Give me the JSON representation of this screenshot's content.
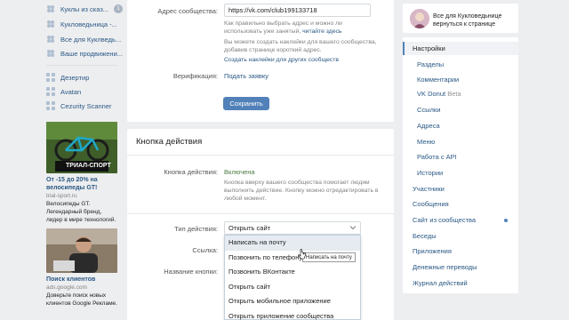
{
  "left_nav": {
    "items": [
      {
        "label": "Куклы из сказ...",
        "count": "1",
        "icon": "doll-icon"
      },
      {
        "label": "Кукловедьница -...",
        "icon": "doll-icon"
      },
      {
        "label": "Все для Куклведь...",
        "icon": "doll-icon"
      },
      {
        "label": "Ваше продвижени...",
        "icon": "doll-icon"
      }
    ],
    "apps": [
      {
        "label": "Дезертир",
        "icon": "app-grid-icon"
      },
      {
        "label": "Avatan",
        "icon": "app-grid-icon"
      },
      {
        "label": "Cezurity Scanner",
        "icon": "app-grid-icon"
      }
    ]
  },
  "ads": [
    {
      "banner_text": "ТРИАЛ-СПОРТ",
      "title": "От -15 до 20% на велосипеды GT!",
      "domain": "trial-sport.ru",
      "desc": "Велосипеды GT. Легендарный бренд, лидер в мире технологий."
    },
    {
      "title": "Поиск клиентов",
      "domain": "ads.google.com",
      "desc": "Доверьте поиск новых клиентов Google Рекламе."
    }
  ],
  "settings": {
    "address_label": "Адрес сообщества:",
    "address_value": "https://vk.com/club199133718",
    "address_hint_1": "Как правильно выбрать адрес и можно ли использовать уже занятый,",
    "address_hint_link": "читайте здесь",
    "sticker_hint": "Вы можете создать наклейки для вашего сообщества, добавив странице короткий адрес.",
    "sticker_link": "Создать наклейки для других сообществ",
    "verification_label": "Верификация:",
    "verification_link": "Подать заявку",
    "save_label": "Сохранить"
  },
  "action_button": {
    "section_title": "Кнопка действия",
    "label": "Кнопка действия:",
    "value": "Включена",
    "desc": "Кнопка вверху вашего сообщества помогает людям выполнить действие. Кнопку можно отредактировать в любой момент.",
    "type_label": "Тип действия:",
    "type_value": "Открыть сайт",
    "link_label": "Ссылка:",
    "name_label": "Название кнопки:",
    "options": [
      "Написать на почту",
      "Позвонить по телефону",
      "Позвонить ВКонтакте",
      "Открыть сайт",
      "Открыть мобильное приложение",
      "Открыть приложение сообщества"
    ],
    "tooltip": "Написать на почту"
  },
  "right_menu": {
    "back_text": "Все для Кукловедьнице вернуться к странице",
    "items": [
      {
        "label": "Настройки",
        "level": "top",
        "selected": true
      },
      {
        "label": "Разделы",
        "level": "sub"
      },
      {
        "label": "Комментарии",
        "level": "sub"
      },
      {
        "label": "VK Donut",
        "beta": "Beta",
        "level": "sub"
      },
      {
        "label": "Ссылки",
        "level": "sub"
      },
      {
        "label": "Адреса",
        "level": "sub"
      },
      {
        "label": "Меню",
        "level": "sub"
      },
      {
        "label": "Работа с API",
        "level": "sub"
      },
      {
        "label": "Истории",
        "level": "sub"
      },
      {
        "label": "Участники",
        "level": "top"
      },
      {
        "label": "Сообщения",
        "level": "top"
      },
      {
        "label": "Сайт из сообщества",
        "level": "top",
        "dot": true
      },
      {
        "label": "Беседы",
        "level": "top"
      },
      {
        "label": "Приложения",
        "level": "top"
      },
      {
        "label": "Денежные переводы",
        "level": "top"
      },
      {
        "label": "Журнал действий",
        "level": "top"
      }
    ]
  },
  "colors": {
    "accent": "#5181b8",
    "link": "#2a5885",
    "bg": "#edeef0"
  }
}
